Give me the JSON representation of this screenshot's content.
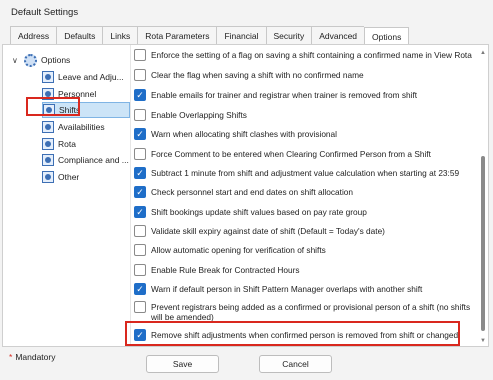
{
  "window": {
    "title": "Default Settings"
  },
  "tabs": [
    {
      "label": "Address",
      "active": false
    },
    {
      "label": "Defaults",
      "active": false
    },
    {
      "label": "Links",
      "active": false
    },
    {
      "label": "Rota Parameters",
      "active": false
    },
    {
      "label": "Financial",
      "active": false
    },
    {
      "label": "Security",
      "active": false
    },
    {
      "label": "Advanced",
      "active": false
    },
    {
      "label": "Options",
      "active": true
    }
  ],
  "tree": {
    "root": {
      "label": "Options",
      "expanded": true,
      "icon": "options-gear-icon"
    },
    "items": [
      {
        "label": "Leave and Adju...",
        "icon": "settings-node-icon",
        "selected": false
      },
      {
        "label": "Personnel",
        "icon": "settings-node-icon",
        "selected": false
      },
      {
        "label": "Shifts",
        "icon": "settings-node-icon",
        "selected": true
      },
      {
        "label": "Availabilities",
        "icon": "settings-node-icon",
        "selected": false
      },
      {
        "label": "Rota",
        "icon": "settings-node-icon",
        "selected": false
      },
      {
        "label": "Compliance and ...",
        "icon": "settings-node-icon",
        "selected": false
      },
      {
        "label": "Other",
        "icon": "settings-node-icon",
        "selected": false
      }
    ]
  },
  "options": [
    {
      "label": "Enforce the setting of a flag on saving a shift containing a confirmed name in View Rota",
      "checked": false
    },
    {
      "label": "Clear the flag when saving a shift with no confirmed name",
      "checked": false
    },
    {
      "label": "Enable emails for trainer and registrar when trainer is removed from shift",
      "checked": true
    },
    {
      "label": "Enable Overlapping Shifts",
      "checked": false
    },
    {
      "label": "Warn when allocating shift clashes with provisional",
      "checked": true
    },
    {
      "label": "Force Comment to be entered when Clearing Confirmed Person from a Shift",
      "checked": false
    },
    {
      "label": "Subtract 1 minute from shift and adjustment value calculation when starting at 23:59",
      "checked": true
    },
    {
      "label": "Check personnel start and end dates on shift allocation",
      "checked": true
    },
    {
      "label": "Shift bookings update shift values based on pay rate group",
      "checked": true
    },
    {
      "label": "Validate skill expiry against date of shift (Default = Today's date)",
      "checked": false
    },
    {
      "label": "Allow automatic opening for verification of shifts",
      "checked": false
    },
    {
      "label": "Enable Rule Break for Contracted Hours",
      "checked": false
    },
    {
      "label": "Warn if default person in Shift Pattern Manager overlaps with another shift",
      "checked": true
    },
    {
      "label": "Prevent registrars being added as a confirmed or provisional person of a shift (no shifts will be amended)",
      "checked": false
    },
    {
      "label": "Remove shift adjustments when confirmed person is removed from shift or changed",
      "checked": true
    }
  ],
  "footer": {
    "mandatory_star": "*",
    "mandatory_label": "Mandatory",
    "save_label": "Save",
    "cancel_label": "Cancel"
  },
  "colors": {
    "checkbox_checked": "#1f6ec8",
    "highlight_box": "#d9281e",
    "tree_selection": "#cce4f7"
  }
}
